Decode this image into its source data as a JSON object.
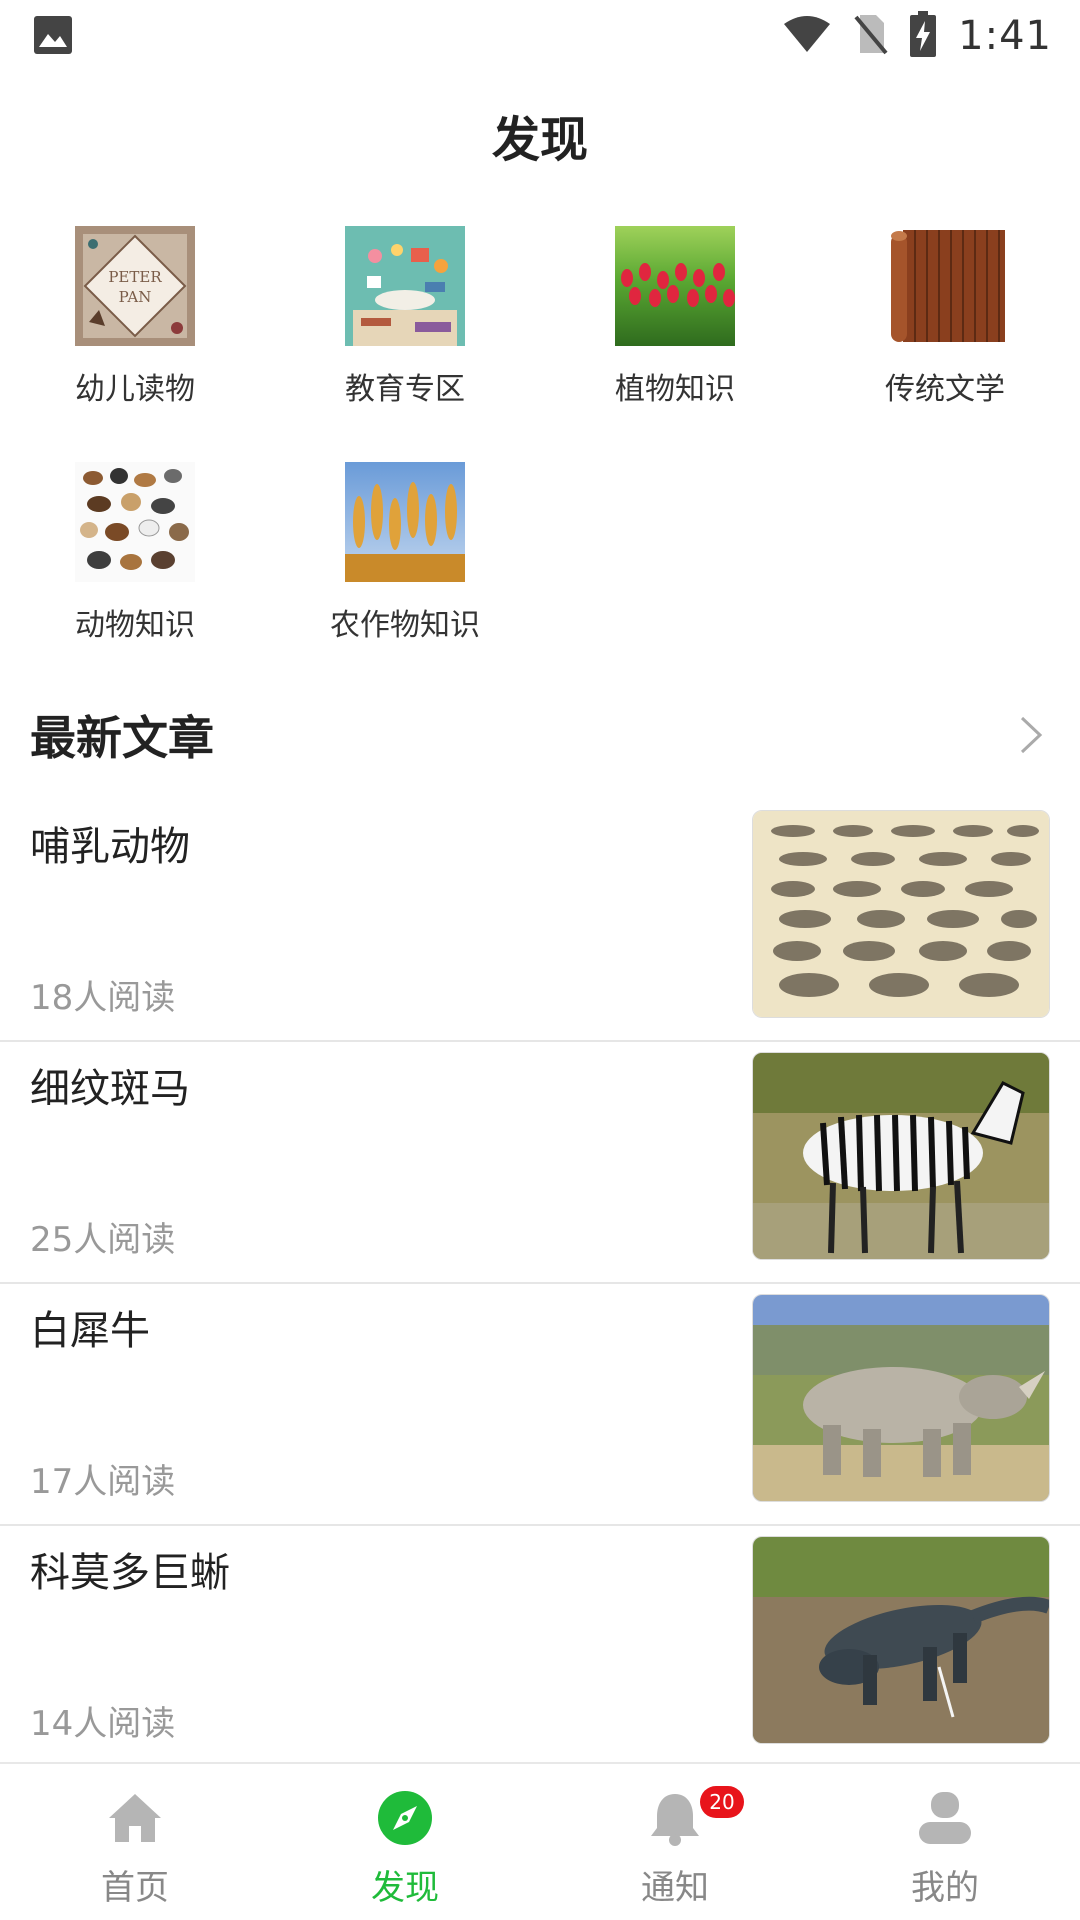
{
  "status_bar": {
    "time": "1:41",
    "icons": [
      "image-icon",
      "wifi-icon",
      "no-sim-icon",
      "battery-charging-icon"
    ]
  },
  "header": {
    "title": "发现"
  },
  "categories": [
    {
      "label": "幼儿读物",
      "icon": "peter-pan-book-cover"
    },
    {
      "label": "教育专区",
      "icon": "education-illustration"
    },
    {
      "label": "植物知识",
      "icon": "tulip-field-photo"
    },
    {
      "label": "传统文学",
      "icon": "bamboo-scroll-photo"
    },
    {
      "label": "动物知识",
      "icon": "animal-collage"
    },
    {
      "label": "农作物知识",
      "icon": "wheat-photo"
    }
  ],
  "latest": {
    "title": "最新文章",
    "more_icon": "chevron-right-icon",
    "articles": [
      {
        "title": "哺乳动物",
        "reads": "18人阅读",
        "image": "mammal-engraving-chart"
      },
      {
        "title": "细纹斑马",
        "reads": "25人阅读",
        "image": "zebra-photo"
      },
      {
        "title": "白犀牛",
        "reads": "17人阅读",
        "image": "white-rhino-photo"
      },
      {
        "title": "科莫多巨蜥",
        "reads": "14人阅读",
        "image": "komodo-dragon-photo"
      }
    ]
  },
  "bottom_nav": {
    "active": "发现",
    "active_color": "#1fbb3a",
    "items": [
      {
        "label": "首页",
        "icon": "home-icon"
      },
      {
        "label": "发现",
        "icon": "compass-icon"
      },
      {
        "label": "通知",
        "icon": "bell-icon",
        "badge": "20"
      },
      {
        "label": "我的",
        "icon": "user-icon"
      }
    ]
  }
}
